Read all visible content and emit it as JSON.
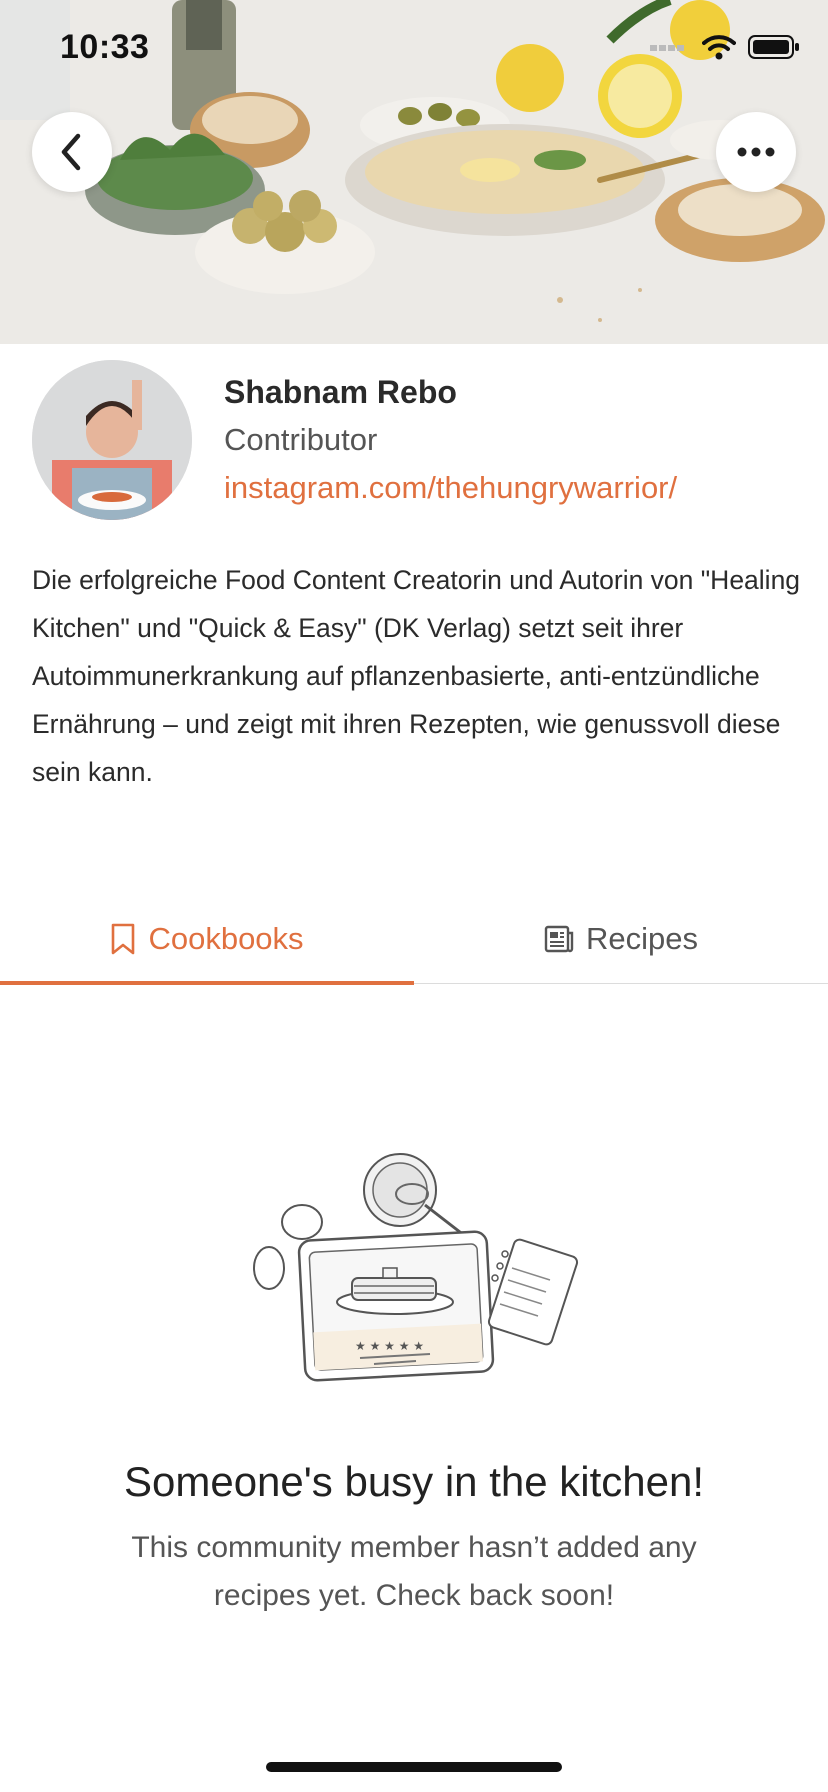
{
  "status_bar": {
    "time": "10:33"
  },
  "header": {
    "back_icon": "chevron-left-icon",
    "more_icon": "more-horizontal-icon"
  },
  "profile": {
    "name": "Shabnam Rebo",
    "role": "Contributor",
    "link": "instagram.com/thehungrywarrior/",
    "bio": "Die erfolgreiche Food Content Creatorin und Autorin von \"Healing Kitchen\" und \"Quick & Easy\" (DK Verlag) setzt seit ihrer Autoimmunerkrankung auf pflanzenbasierte, anti-entzündliche Ernährung – und  zeigt mit ihren Rezepten, wie genussvoll diese sein kann."
  },
  "tabs": [
    {
      "label": "Cookbooks",
      "icon": "bookmark-icon",
      "active": true
    },
    {
      "label": "Recipes",
      "icon": "newspaper-icon",
      "active": false
    }
  ],
  "empty_state": {
    "title": "Someone's busy in the kitchen!",
    "message": "This community member hasn’t added any recipes yet. Check back soon!"
  },
  "colors": {
    "accent": "#e0703f",
    "text": "#2b2b2b",
    "muted": "#555555"
  }
}
